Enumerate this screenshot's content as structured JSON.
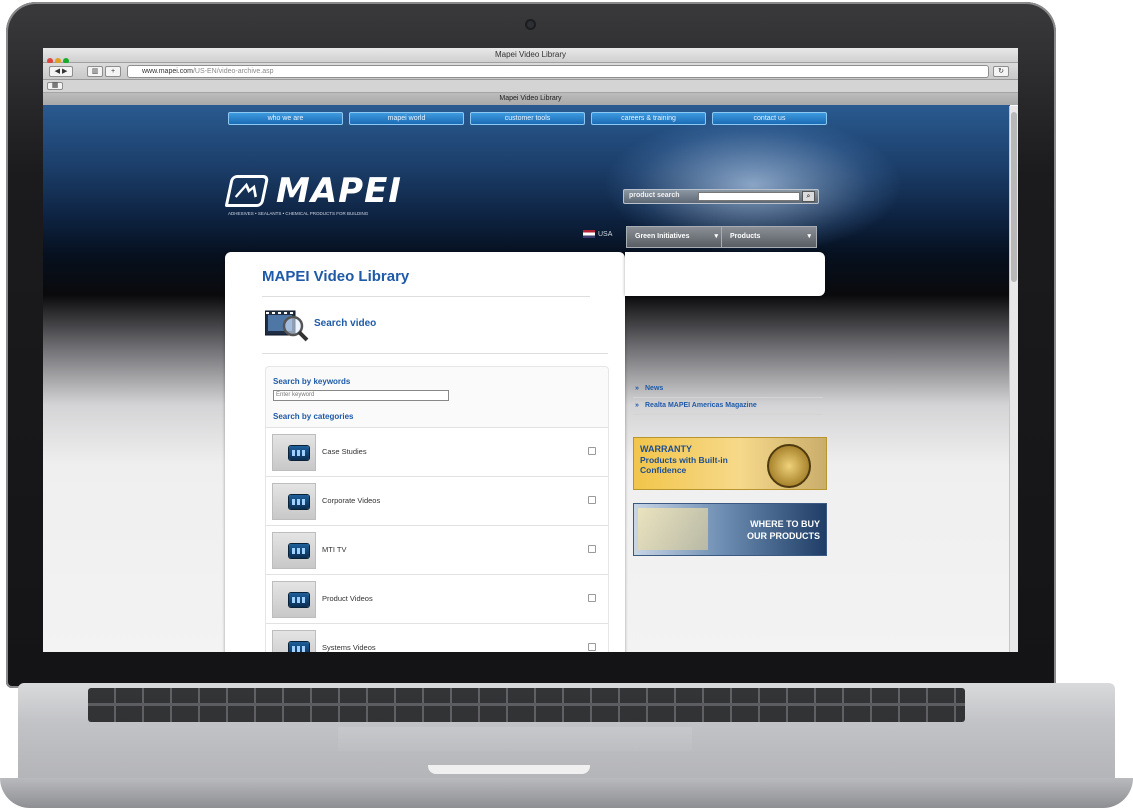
{
  "browser": {
    "window_title": "Mapei Video Library",
    "url_host": "www.mapei.com",
    "url_path": "/US-EN/video-archive.asp",
    "tab_title": "Mapei Video Library"
  },
  "site": {
    "top_nav": [
      "who we are",
      "mapei world",
      "customer tools",
      "careers & training",
      "contact us"
    ],
    "logo_text": "MAPEI",
    "logo_tagline": "ADHESIVES • SEALANTS • CHEMICAL PRODUCTS FOR BUILDING",
    "product_search_label": "product search",
    "flag_label": "USA",
    "dropdowns": [
      "Green Initiatives",
      "Products"
    ]
  },
  "library": {
    "title": "MAPEI Video Library",
    "search_video": "Search video",
    "keywords_label": "Search by keywords",
    "keywords_placeholder": "Enter keyword",
    "categories_label": "Search by categories",
    "categories": [
      "Case Studies",
      "Corporate Videos",
      "MTI TV",
      "Product Videos",
      "Systems Videos"
    ]
  },
  "sidebar": {
    "links": [
      "News",
      "Realta MAPEI Americas Magazine"
    ],
    "warranty_heading": "WARRANTY",
    "warranty_text": "Products with Built-in Confidence",
    "where_to_buy": "WHERE TO BUY OUR PRODUCTS"
  },
  "colors": {
    "link_blue": "#1e5aa8",
    "nav_blue": "#1a6cb5"
  }
}
